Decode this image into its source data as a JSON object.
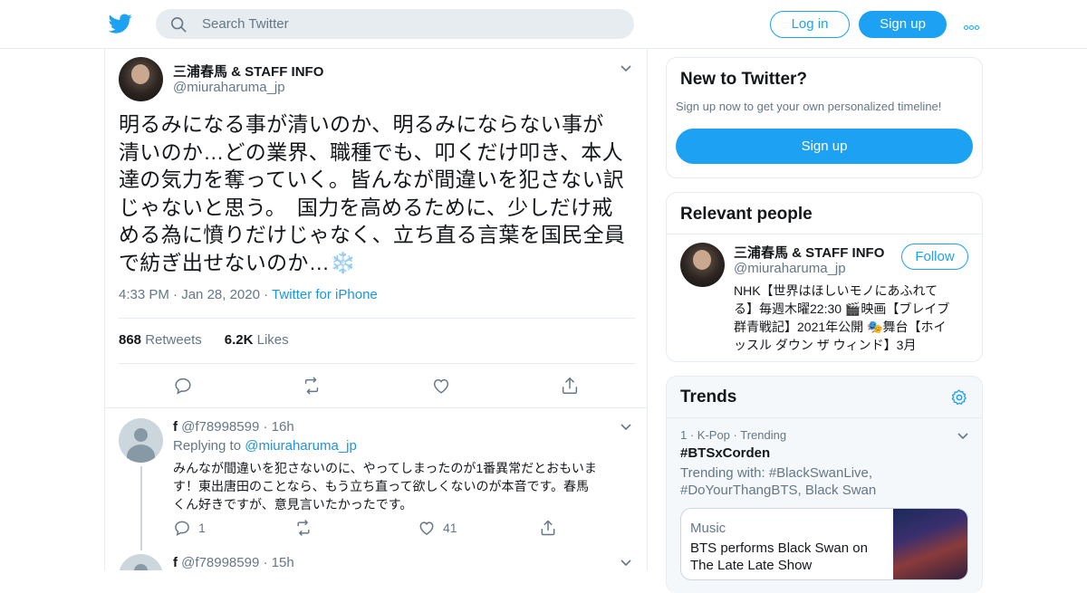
{
  "header": {
    "search_placeholder": "Search Twitter",
    "login_label": "Log in",
    "signup_label": "Sign up",
    "brand_color": "#1da1f2"
  },
  "tweet": {
    "author_name": "三浦春馬 & STAFF INFO",
    "author_handle": "@miuraharuma_jp",
    "text_lines": [
      "明るみになる事が清いのか、明るみにならない事が",
      "清いのか…どの業界、職種でも、叩くだけ叩き、本人",
      "達の気力を奪っていく。皆んなが間違いを犯さない訳",
      "じゃないと思う。　国力を高めるために、少しだけ戒",
      "める為に憤りだけじゃなく、立ち直る言葉を国民全員",
      "で紡ぎ出せないのか…❄️"
    ],
    "time": "4:33 PM",
    "date": "Jan 28, 2020",
    "source": "Twitter for iPhone",
    "retweets_count": "868",
    "retweets_label": "Retweets",
    "likes_count": "6.2K",
    "likes_label": "Likes"
  },
  "replies": [
    {
      "name": "f",
      "handle": "@f78998599",
      "age": "16h",
      "replying_label": "Replying to",
      "replying_to": "@miuraharuma_jp",
      "text_lines": [
        "みんなが間違いを犯さないのに、やってしまったのが1番異常だとおもいま",
        "す！東出唐田のことなら、もう立ち直って欲しくないのが本音です。春馬",
        "くん好きですが、意見言いたかったです。"
      ],
      "reply_count": "1",
      "like_count": "41"
    },
    {
      "name": "f",
      "handle": "@f78998599",
      "age": "15h"
    }
  ],
  "sidebar": {
    "new_to_twitter": {
      "title": "New to Twitter?",
      "subtitle": "Sign up now to get your own personalized timeline!",
      "signup_label": "Sign up"
    },
    "relevant_people": {
      "title": "Relevant people",
      "name": "三浦春馬 & STAFF INFO",
      "handle": "@miuraharuma_jp",
      "follow_label": "Follow",
      "bio_lines": [
        "NHK【世界はほしいモノにあふれて",
        "る】毎週木曜22:30 🎬映画【ブレイブ",
        "群青戦記】2021年公開 🎭舞台【ホイ",
        "ッスル ダウン ザ ウィンド】3月"
      ]
    },
    "trends": {
      "title": "Trends",
      "rank_meta": "1 · K-Pop · Trending",
      "tag": "#BTSxCorden",
      "trending_with_lines": [
        "Trending with: #BlackSwanLive,",
        "#DoYourThangBTS, Black Swan"
      ],
      "card_source": "Music",
      "card_title": "BTS performs Black Swan on The Late Late Show"
    }
  }
}
